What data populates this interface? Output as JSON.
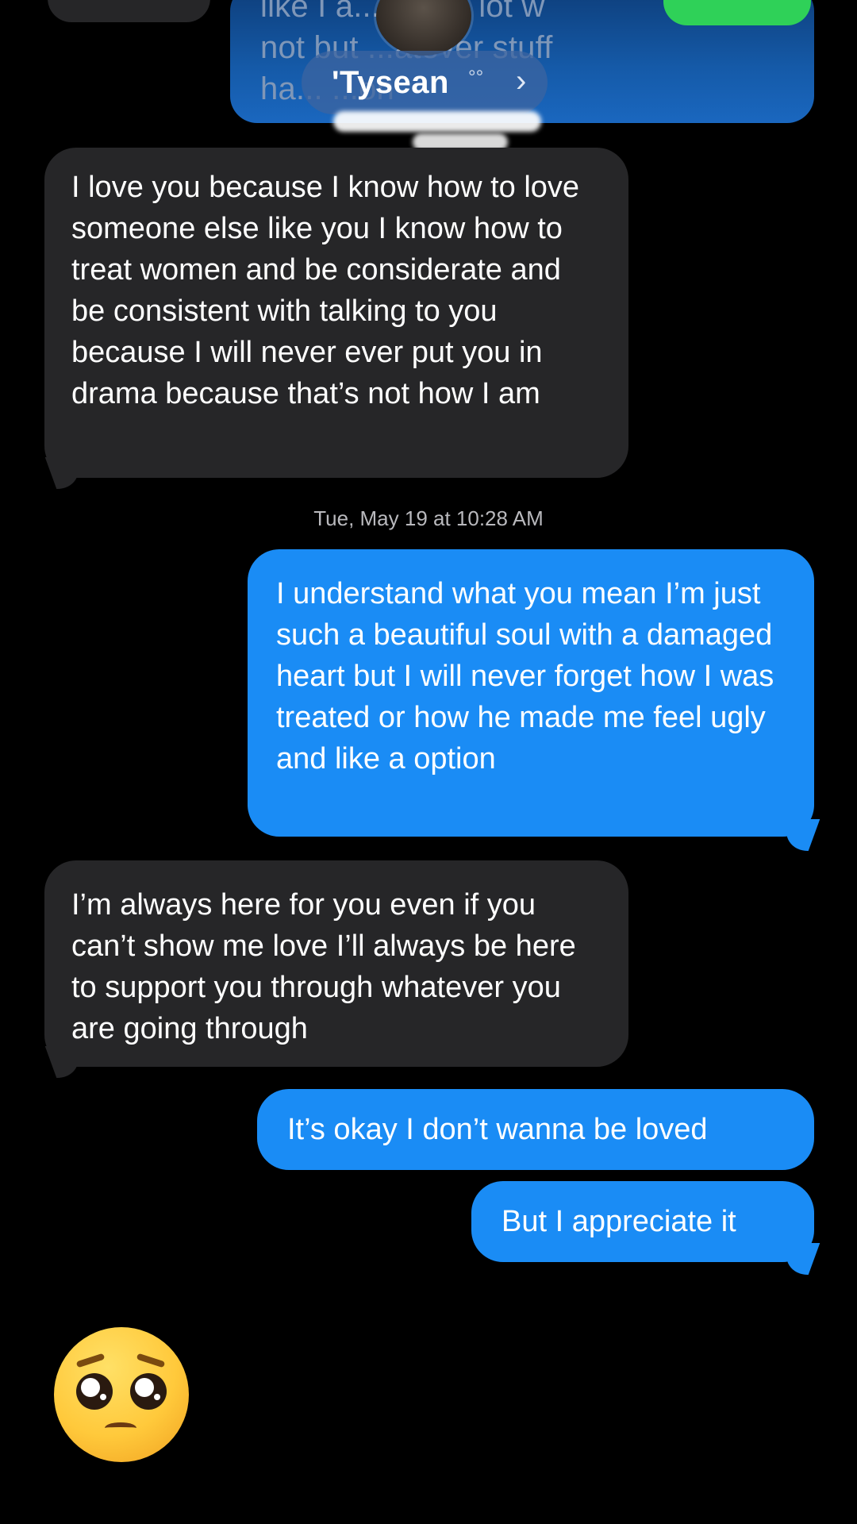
{
  "header": {
    "contact_name": "'Tysean",
    "status_glyph": "°°",
    "chevron": "›",
    "top_partial_text": "like I a... ...ot a lot w\nnot but ...atever stuff\nha... ...on"
  },
  "messages": [
    {
      "side": "received",
      "text": "I love you because I know how to love someone else like you I know how to treat women and be considerate and be consistent with talking to you because I will never ever put you in drama because that’s not how I am"
    },
    {
      "side": "sent",
      "text": "I understand what you mean I’m just such a beautiful soul with a damaged heart but I will never forget how I was treated or how he made me feel ugly and like a option"
    },
    {
      "side": "received",
      "text": "I’m always here for you even if you can’t show me love I’ll always be here to support you through whatever you are going through"
    },
    {
      "side": "sent",
      "text": "It’s okay I don’t wanna be loved"
    },
    {
      "side": "sent",
      "text": "But I appreciate it"
    }
  ],
  "timestamp": "Tue, May 19 at 10:28 AM",
  "overlay_emoji": "pleading-face-emoji",
  "colors": {
    "background": "#000000",
    "received_bubble": "#262628",
    "sent_bubble": "#1a8cf5",
    "timestamp_text": "#b9b9bd"
  }
}
